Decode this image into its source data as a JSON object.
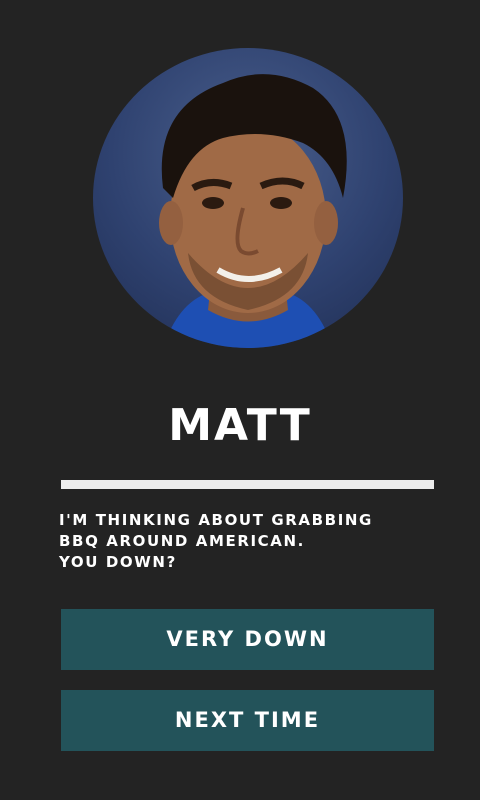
{
  "profile": {
    "name": "MATT",
    "photo_alt": "avatar"
  },
  "message": {
    "lines": [
      "I'M THINKING ABOUT GRABBING",
      "BBQ AROUND AMERICAN.",
      "YOU DOWN?"
    ]
  },
  "actions": {
    "primary_label": "VERY DOWN",
    "secondary_label": "NEXT TIME"
  },
  "colors": {
    "background": "#232323",
    "divider": "#ececec",
    "button": "#23535a",
    "text": "#ffffff"
  }
}
